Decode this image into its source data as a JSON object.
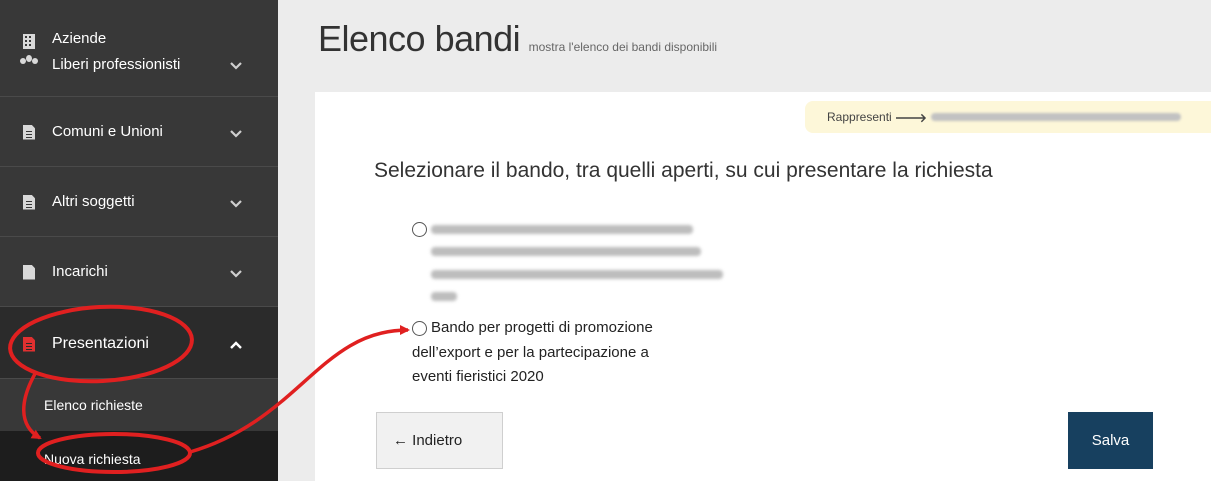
{
  "sidebar": {
    "items": [
      {
        "label_line1": "Aziende",
        "label_line2": "Liberi professionisti"
      },
      {
        "label": "Comuni e Unioni"
      },
      {
        "label": "Altri soggetti"
      },
      {
        "label": "Incarichi"
      },
      {
        "label": "Presentazioni"
      }
    ],
    "sub_items": [
      {
        "label": "Elenco richieste"
      },
      {
        "label": "Nuova richiesta"
      }
    ]
  },
  "header": {
    "title": "Elenco bandi",
    "subtitle": "mostra l'elenco dei bandi disponibili"
  },
  "rep_badge": {
    "label": "Rappresenti",
    "arrow": "🡒",
    "value": ""
  },
  "main": {
    "heading": "Selezionare il bando, tra quelli aperti, su cui presentare la richiesta",
    "options": [
      {
        "label": "",
        "selected": false
      },
      {
        "label_line1": "Bando per progetti di promozione",
        "label_line2": "dell’export e per la partecipazione a",
        "label_line3": "eventi fieristici 2020",
        "selected": false
      }
    ]
  },
  "buttons": {
    "back": "← Indietro",
    "save": "Salva"
  },
  "colors": {
    "sidebar_bg": "#383838",
    "accent_red": "#e03030",
    "annotation_red": "#e02020",
    "save_bg": "#17405f",
    "badge_bg": "#fdf7d9"
  }
}
